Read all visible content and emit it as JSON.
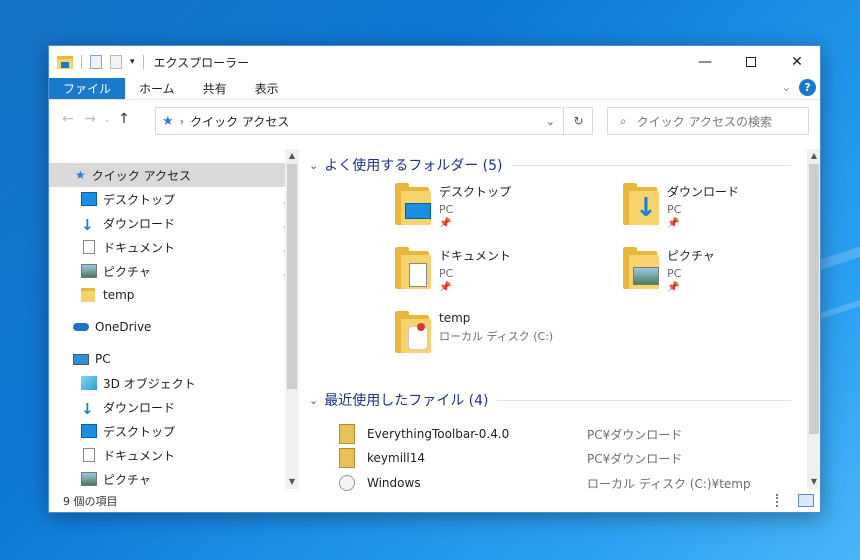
{
  "window": {
    "title": "エクスプローラー"
  },
  "ribbon": {
    "tabs": [
      "ファイル",
      "ホーム",
      "共有",
      "表示"
    ]
  },
  "address": {
    "path": "クイック アクセス"
  },
  "search": {
    "placeholder": "クイック アクセスの検索"
  },
  "nav": {
    "quick_access": "クイック アクセス",
    "pinned": [
      "デスクトップ",
      "ダウンロード",
      "ドキュメント",
      "ピクチャ"
    ],
    "temp": "temp",
    "onedrive": "OneDrive",
    "pc": "PC",
    "pc_items": [
      "3D オブジェクト",
      "ダウンロード",
      "デスクトップ",
      "ドキュメント",
      "ピクチャ"
    ]
  },
  "content": {
    "frequent_header": "よく使用するフォルダー (5)",
    "frequent": [
      {
        "name": "デスクトップ",
        "location": "PC"
      },
      {
        "name": "ダウンロード",
        "location": "PC"
      },
      {
        "name": "ドキュメント",
        "location": "PC"
      },
      {
        "name": "ピクチャ",
        "location": "PC"
      },
      {
        "name": "temp",
        "location": "ローカル ディスク (C:)"
      }
    ],
    "recent_header": "最近使用したファイル (4)",
    "recent": [
      {
        "name": "EverythingToolbar-0.4.0",
        "path": "PC¥ダウンロード"
      },
      {
        "name": "keymill14",
        "path": "PC¥ダウンロード"
      },
      {
        "name": "Windows",
        "path": "ローカル ディスク (C:)¥temp"
      }
    ]
  },
  "status": {
    "count": "9 個の項目"
  },
  "colors": {
    "accent": "#1979ca",
    "group_header": "#1e3287",
    "folder": "#f6d36c"
  }
}
